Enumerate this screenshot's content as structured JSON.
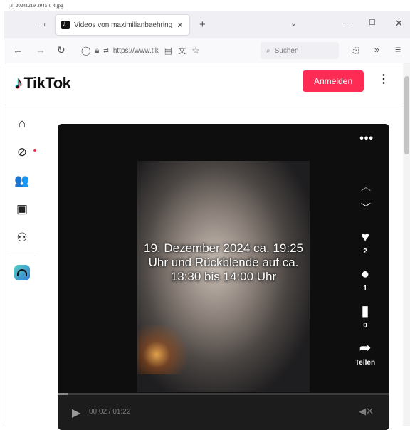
{
  "caption": "[3] 20241219-2045-0-4.jpg",
  "browser": {
    "tab_title": "Videos von maximilianbaehring",
    "tab_close": "✕",
    "new_tab": "+",
    "url": "https://www.tik",
    "search_placeholder": "Suchen"
  },
  "page": {
    "logo_text": "TikTok",
    "login_label": "Anmelden",
    "more_label": "⋮",
    "sidebar": [
      {
        "name": "home",
        "glyph": "⌂"
      },
      {
        "name": "explore",
        "glyph": "⊘"
      },
      {
        "name": "following",
        "glyph": "👥"
      },
      {
        "name": "live-video",
        "glyph": "▣"
      },
      {
        "name": "profile",
        "glyph": "⚇"
      }
    ]
  },
  "video": {
    "overlay_text": "19. Dezember 2024 ca. 19:25 Uhr und Rückblende auf ca. 13:30 bis 14:00 Uhr",
    "likes": "2",
    "comments": "1",
    "saves": "0",
    "share_label": "Teilen",
    "time": "00:02 / 01:22",
    "progress": 0.03
  }
}
